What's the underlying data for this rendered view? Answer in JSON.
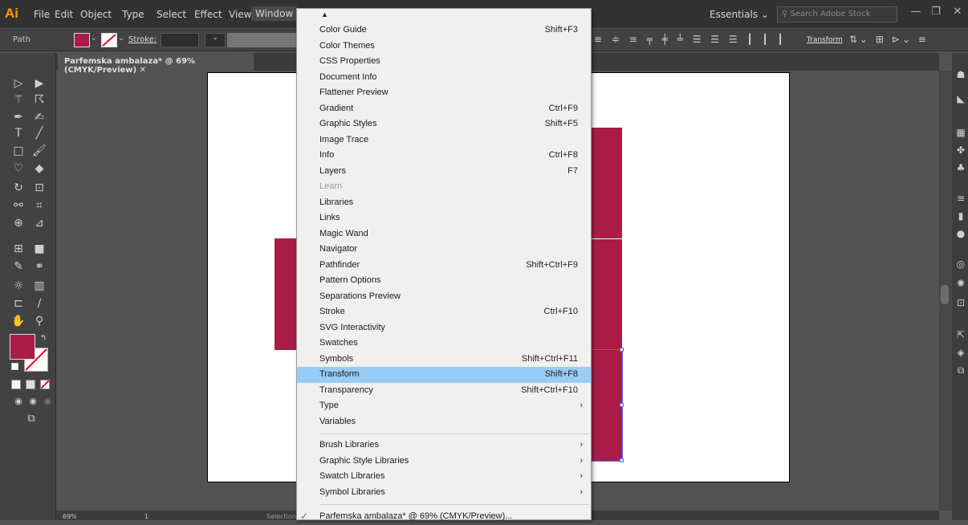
{
  "app": {
    "logo": "Ai"
  },
  "menubar": [
    "File",
    "Edit",
    "Object",
    "Type",
    "Select",
    "Effect",
    "View",
    "Window"
  ],
  "workspace": "Essentials",
  "stock_placeholder": "Search Adobe Stock",
  "control": {
    "path_label": "Path",
    "stroke_label": "Stroke:",
    "transform_label": "Transform"
  },
  "document_tab": "Parfemska ambalaza* @ 69% (CMYK/Preview)",
  "status": {
    "zoom": "69%",
    "page": "1",
    "mode": "Selection"
  },
  "colors": {
    "fill": "#a91c47",
    "highlight": "#99ccf5",
    "accent": "#ff9a00"
  },
  "window_menu": {
    "scroll_indicator": "▲",
    "items": [
      {
        "label": "Color Guide",
        "shortcut": "Shift+F3"
      },
      {
        "label": "Color Themes",
        "shortcut": ""
      },
      {
        "label": "CSS Properties",
        "shortcut": ""
      },
      {
        "label": "Document Info",
        "shortcut": ""
      },
      {
        "label": "Flattener Preview",
        "shortcut": ""
      },
      {
        "label": "Gradient",
        "shortcut": "Ctrl+F9"
      },
      {
        "label": "Graphic Styles",
        "shortcut": "Shift+F5"
      },
      {
        "label": "Image Trace",
        "shortcut": ""
      },
      {
        "label": "Info",
        "shortcut": "Ctrl+F8"
      },
      {
        "label": "Layers",
        "shortcut": "F7"
      },
      {
        "label": "Learn",
        "shortcut": "",
        "disabled": true
      },
      {
        "label": "Libraries",
        "shortcut": ""
      },
      {
        "label": "Links",
        "shortcut": ""
      },
      {
        "label": "Magic Wand",
        "shortcut": ""
      },
      {
        "label": "Navigator",
        "shortcut": ""
      },
      {
        "label": "Pathfinder",
        "shortcut": "Shift+Ctrl+F9"
      },
      {
        "label": "Pattern Options",
        "shortcut": ""
      },
      {
        "label": "Separations Preview",
        "shortcut": ""
      },
      {
        "label": "Stroke",
        "shortcut": "Ctrl+F10"
      },
      {
        "label": "SVG Interactivity",
        "shortcut": ""
      },
      {
        "label": "Swatches",
        "shortcut": ""
      },
      {
        "label": "Symbols",
        "shortcut": "Shift+Ctrl+F11"
      },
      {
        "label": "Transform",
        "shortcut": "Shift+F8",
        "highlighted": true
      },
      {
        "label": "Transparency",
        "shortcut": "Shift+Ctrl+F10"
      },
      {
        "label": "Type",
        "shortcut": "",
        "submenu": true
      },
      {
        "label": "Variables",
        "shortcut": ""
      }
    ],
    "libraries": [
      {
        "label": "Brush Libraries"
      },
      {
        "label": "Graphic Style Libraries"
      },
      {
        "label": "Swatch Libraries"
      },
      {
        "label": "Symbol Libraries"
      }
    ],
    "open_document": "Parfemska ambalaza* @ 69% (CMYK/Preview)..."
  }
}
